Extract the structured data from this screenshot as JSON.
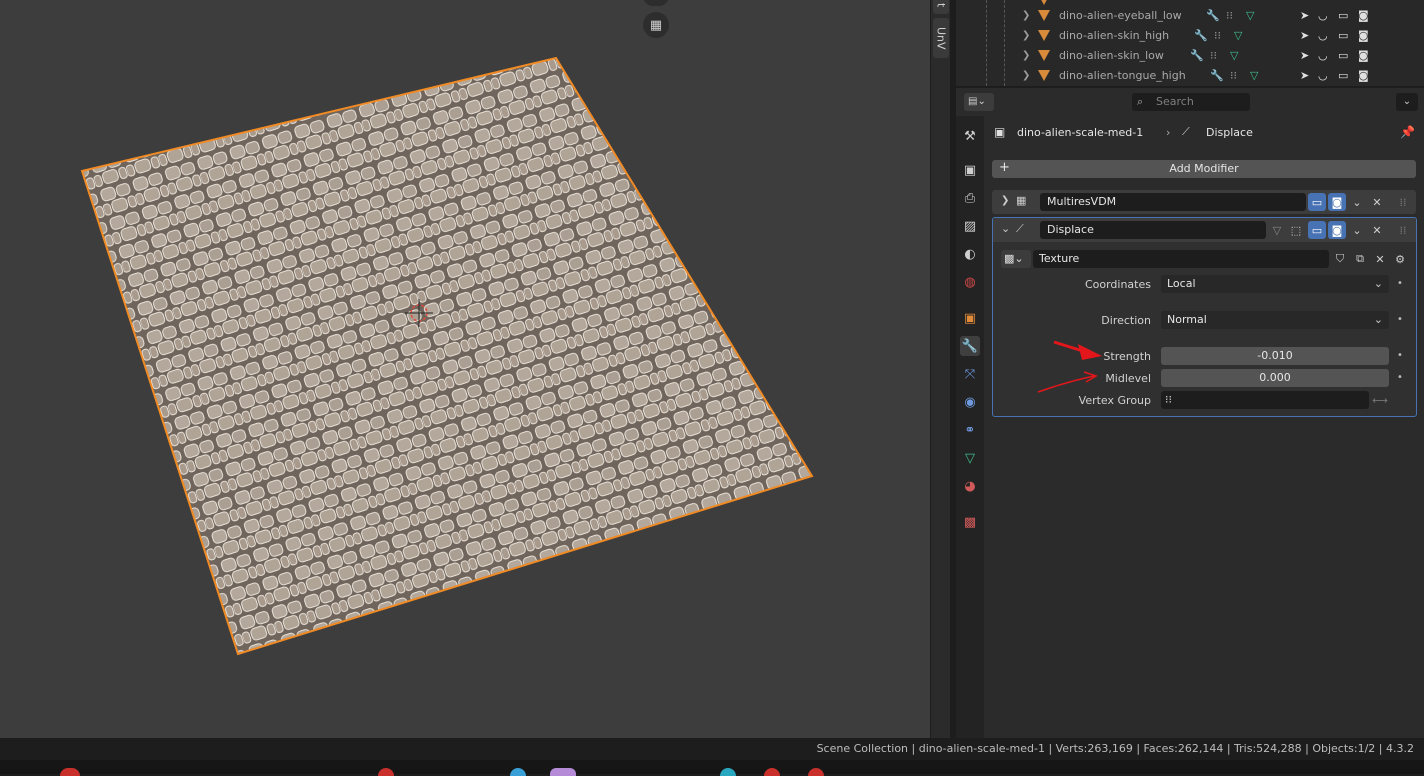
{
  "viewport": {
    "uv_tab": "UnV",
    "edge_tab": "t"
  },
  "outliner": {
    "rows": [
      {
        "name": "dino-alien-eyeball_low"
      },
      {
        "name": "dino-alien-skin_high"
      },
      {
        "name": "dino-alien-skin_low"
      },
      {
        "name": "dino-alien-tongue_high"
      }
    ]
  },
  "properties": {
    "search_placeholder": "Search",
    "breadcrumb_object": "dino-alien-scale-med-1",
    "breadcrumb_modifier": "Displace",
    "add_modifier_label": "Add Modifier",
    "modifiers": [
      {
        "name": "MultiresVDM",
        "expanded": false
      },
      {
        "name": "Displace",
        "expanded": true
      }
    ],
    "texture_label": "Texture",
    "fields": {
      "coordinates_label": "Coordinates",
      "coordinates_value": "Local",
      "direction_label": "Direction",
      "direction_value": "Normal",
      "strength_label": "Strength",
      "strength_value": "-0.010",
      "midlevel_label": "Midlevel",
      "midlevel_value": "0.000",
      "vertex_group_label": "Vertex Group",
      "vertex_group_value": ""
    }
  },
  "status": {
    "text": "Scene Collection | dino-alien-scale-med-1 | Verts:263,169 | Faces:262,144 | Tris:524,288 | Objects:1/2 | 4.3.2"
  },
  "colors": {
    "accent": "#4772b3",
    "selection_outline": "#f08a24",
    "annotation_arrow": "#e3161b",
    "mesh_base": "#a89b8e"
  }
}
